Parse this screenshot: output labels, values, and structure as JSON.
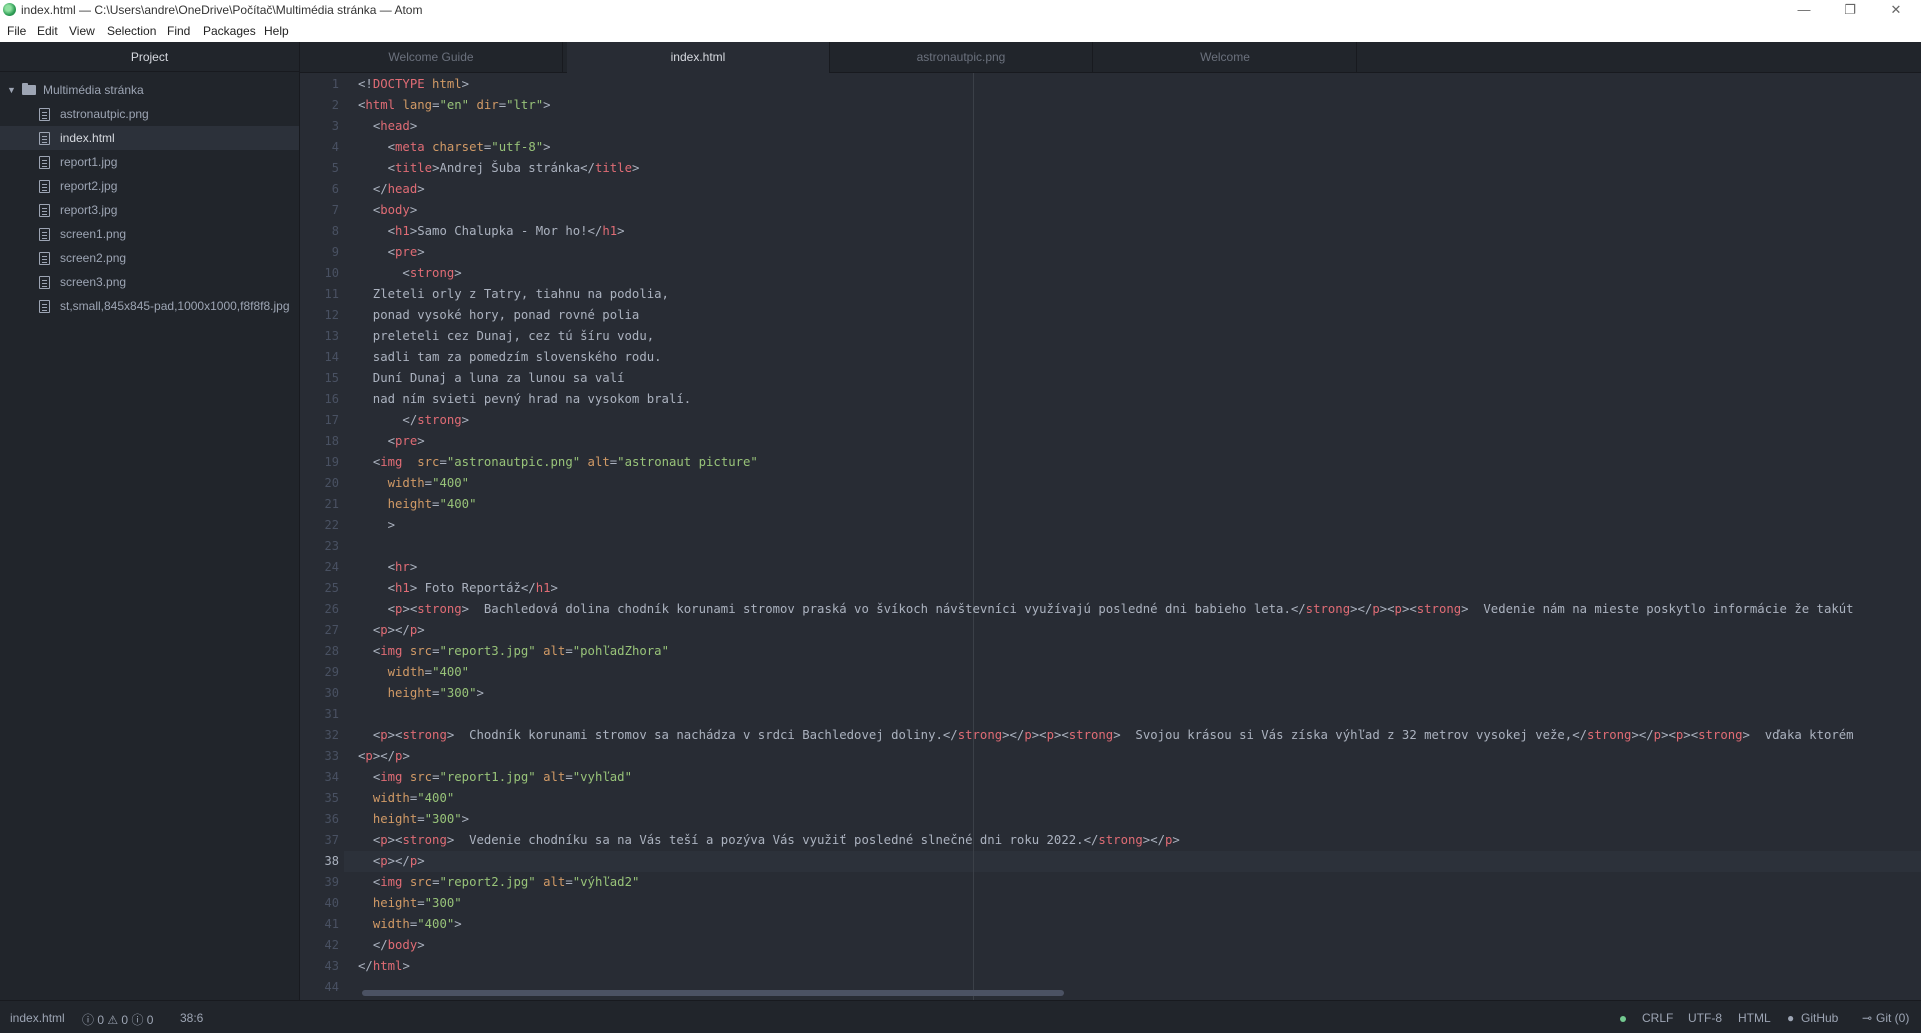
{
  "window": {
    "title": "index.html — C:\\Users\\andre\\OneDrive\\Počítač\\Multimédia stránka — Atom",
    "minimize": "—",
    "maximize": "❐",
    "close": "✕"
  },
  "menu": [
    "File",
    "Edit",
    "View",
    "Selection",
    "Find",
    "Packages",
    "Help"
  ],
  "sidebar": {
    "header": "Project",
    "root": "Multimédia stránka",
    "files": [
      "astronautpic.png",
      "index.html",
      "report1.jpg",
      "report2.jpg",
      "report3.jpg",
      "screen1.png",
      "screen2.png",
      "screen3.png",
      "st,small,845x845-pad,1000x1000,f8f8f8.jpg"
    ],
    "selected_file": "index.html"
  },
  "tabs": [
    {
      "label": "Welcome Guide",
      "active": false
    },
    {
      "label": "index.html",
      "active": true
    },
    {
      "label": "astronautpic.png",
      "active": false
    },
    {
      "label": "Welcome",
      "active": false
    }
  ],
  "editor": {
    "cursor_line": 38,
    "lines": [
      "<!DOCTYPE html>",
      "<html lang=\"en\" dir=\"ltr\">",
      "  <head>",
      "    <meta charset=\"utf-8\">",
      "    <title>Andrej Šuba stránka</title>",
      "  </head>",
      "  <body>",
      "    <h1>Samo Chalupka - Mor ho!</h1>",
      "    <pre>",
      "      <strong>",
      "  Zleteli orly z Tatry, tiahnu na podolia,",
      "  ponad vysoké hory, ponad rovné polia",
      "  preleteli cez Dunaj, cez tú šíru vodu,",
      "  sadli tam za pomedzím slovenského rodu.",
      "  Duní Dunaj a luna za lunou sa valí",
      "  nad ním svieti pevný hrad na vysokom bralí.",
      "      </strong>",
      "    <pre>",
      "  <img  src=\"astronautpic.png\" alt=\"astronaut picture\"",
      "    width=\"400\"",
      "    height=\"400\"",
      "    >",
      "",
      "    <hr>",
      "    <h1> Foto Reportáž</h1>",
      "    <p><strong>  Bachledová dolina chodník korunami stromov praská vo švíkoch návštevníci využívajú posledné dni babieho leta.</strong></p><p><strong>  Vedenie nám na mieste poskytlo informácie že takút",
      "  <p></p>",
      "  <img src=\"report3.jpg\" alt=\"pohľadZhora\"",
      "    width=\"400\"",
      "    height=\"300\">",
      "",
      "  <p><strong>  Chodník korunami stromov sa nachádza v srdci Bachledovej doliny.</strong></p><p><strong>  Svojou krásou si Vás získa výhľad z 32 metrov vysokej veže,</strong></p><p><strong>  vďaka ktorém",
      "<p></p>",
      "  <img src=\"report1.jpg\" alt=\"vyhľad\"",
      "  width=\"400\"",
      "  height=\"300\">",
      "  <p><strong>  Vedenie chodníku sa na Vás teší a pozýva Vás využiť posledné slnečné dni roku 2022.</strong></p>",
      "  <p></p>",
      "  <img src=\"report2.jpg\" alt=\"výhľad2\"",
      "  height=\"300\"",
      "  width=\"400\">",
      "  </body>",
      "</html>",
      ""
    ]
  },
  "status": {
    "file": "index.html",
    "diagnostics": "ⓘ 0 ⚠ 0 ⓘ 0",
    "cursor_pos": "38:6",
    "line_ending": "CRLF",
    "encoding": "UTF-8",
    "grammar": "HTML",
    "github": "GitHub",
    "git": "Git (0)"
  },
  "colors": {
    "tag": "#e06c75",
    "attribute": "#d19a66",
    "string": "#98c379",
    "editor_bg": "#282c34",
    "panel_bg": "#21252b"
  }
}
